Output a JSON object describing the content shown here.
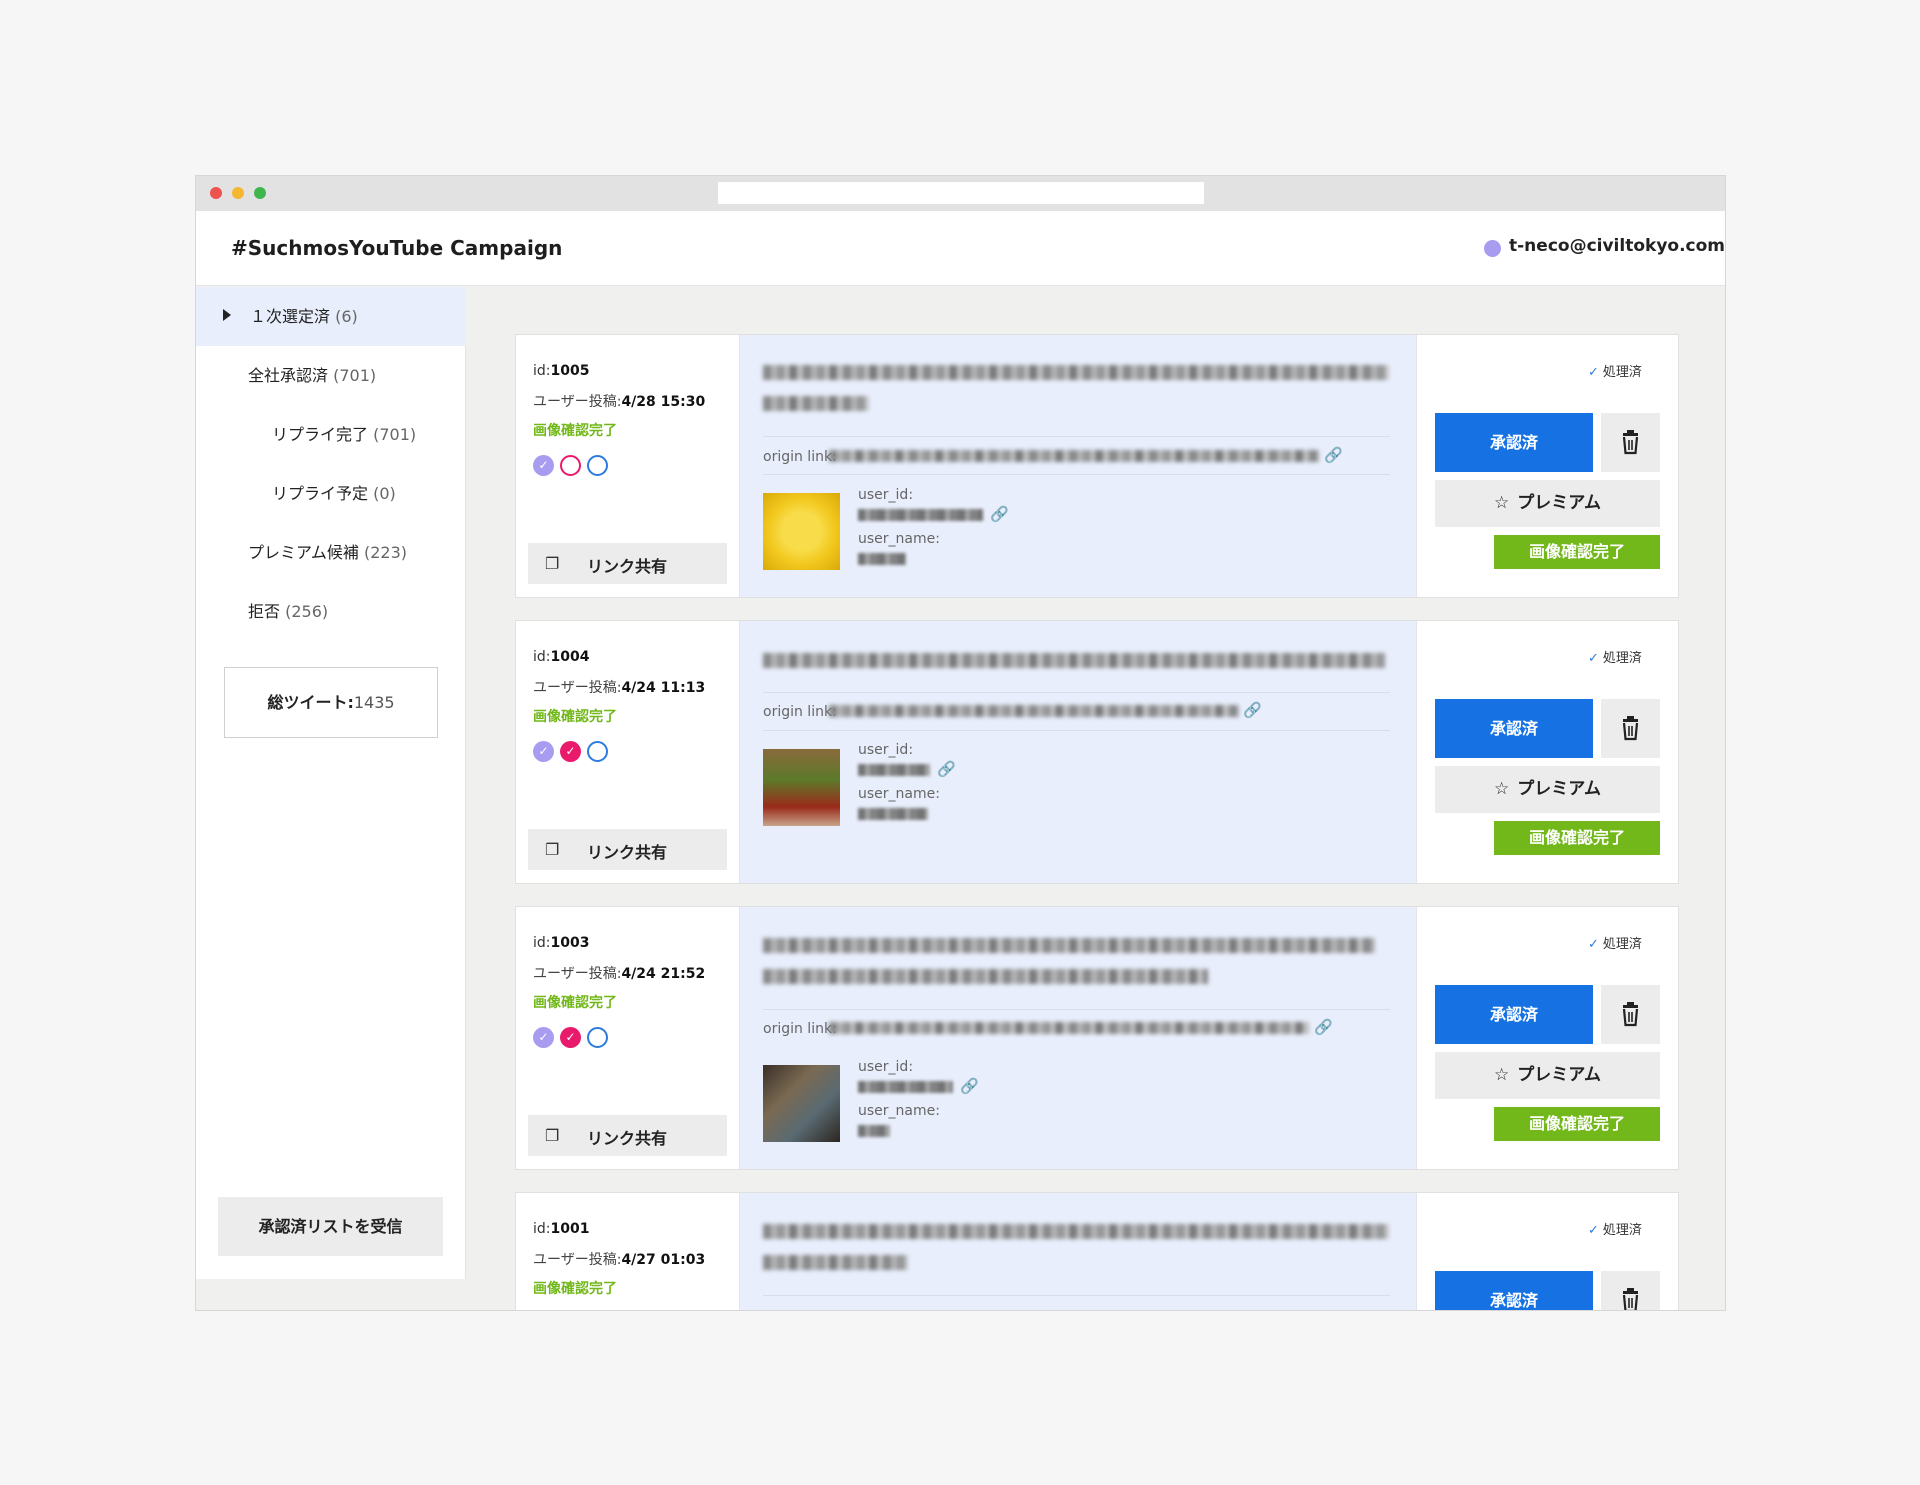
{
  "app": {
    "title": "#SuchmosYouTube Campaign",
    "user_email": "t-neco@civiltokyo.com"
  },
  "sidebar": {
    "items": [
      {
        "label": "１次選定済",
        "count": "(6)",
        "active": true
      },
      {
        "label": "全社承認済",
        "count": "(701)"
      },
      {
        "label": "リプライ完了",
        "count": "(701)"
      },
      {
        "label": "リプライ予定",
        "count": "(0)"
      },
      {
        "label": "プレミアム候補",
        "count": "(223)"
      },
      {
        "label": "拒否",
        "count": "(256)"
      }
    ],
    "total_label": "総ツイート:",
    "total_value": "1435",
    "receive_button": "承認済リストを受信"
  },
  "labels": {
    "id_prefix": "id:",
    "posted_prefix": "ユーザー投稿:",
    "image_confirmed": "画像確認完了",
    "share_link": "リンク共有",
    "origin_link": "origin link:",
    "user_id": "user_id:",
    "user_name": "user_name:",
    "processed": "処理済",
    "approved": "承認済",
    "premium": "プレミアム",
    "image_confirm_button": "画像確認完了"
  },
  "posts": [
    {
      "id": "1005",
      "date": "4/28 15:30",
      "status": [
        "purple-checked",
        "pink-empty",
        "blue-empty"
      ]
    },
    {
      "id": "1004",
      "date": "4/24 11:13",
      "status": [
        "purple-checked",
        "pink-checked",
        "blue-empty"
      ]
    },
    {
      "id": "1003",
      "date": "4/24 21:52",
      "status": [
        "purple-checked",
        "pink-checked",
        "blue-empty"
      ]
    },
    {
      "id": "1001",
      "date": "4/27 01:03",
      "status": [
        "purple-checked",
        "pink-empty",
        "blue-empty"
      ]
    }
  ],
  "icons": {
    "copy": "copy-icon",
    "link": "link-icon",
    "trash": "trash-icon",
    "star": "star-outline-icon",
    "check": "check-icon",
    "user": "user-avatar-dot",
    "nav_arrow": "triangle-right-icon"
  },
  "colors": {
    "primary_blue": "#1672e3",
    "confirm_green": "#72b81a",
    "status_pink": "#e9196c",
    "status_purple": "#a89cf0",
    "active_nav_bg": "#e8eefb"
  }
}
